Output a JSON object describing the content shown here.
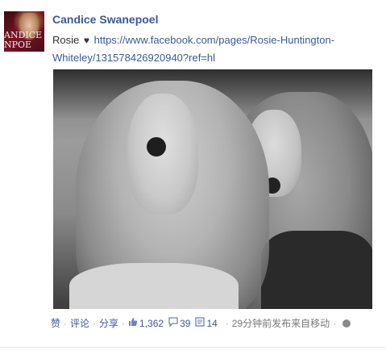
{
  "author": {
    "name": "Candice Swanepoel",
    "avatar_text": "ANDICE\nNPOE"
  },
  "post": {
    "text_prefix": "Rosie",
    "heart": "♥",
    "link": "https://www.facebook.com/pages/Rosie-Huntington-Whiteley/131578426920940?ref=hl"
  },
  "photo": {
    "icon": "photo-bw"
  },
  "actions": {
    "like": "赞",
    "comment": "评论",
    "share": "分享",
    "likes_count": "1,362",
    "comments_count": "39",
    "shares_count": "14",
    "timestamp": "29分钟前发布来自移动",
    "like_icon": "thumbs-up-icon",
    "comment_icon": "comment-bubble-icon",
    "share_icon": "share-icon",
    "privacy_icon": "globe-icon"
  }
}
